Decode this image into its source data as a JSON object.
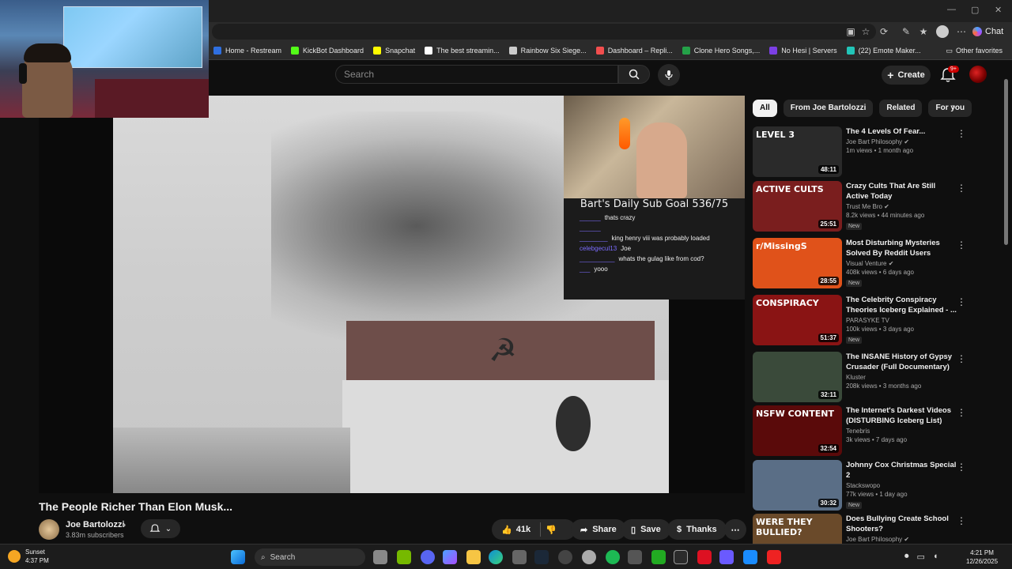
{
  "window": {
    "minimize": "—",
    "maximize": "▢",
    "close": "✕"
  },
  "address_bar": {
    "chat_label": "Chat"
  },
  "bookmarks": [
    {
      "label": "Home - Restream",
      "color": "#2f6fe0"
    },
    {
      "label": "KickBot Dashboard",
      "color": "#53fc18"
    },
    {
      "label": "Snapchat",
      "color": "#fffc00"
    },
    {
      "label": "The best streamin...",
      "color": "#ffffff"
    },
    {
      "label": "Rainbow Six Siege...",
      "color": "#cccccc"
    },
    {
      "label": "Dashboard – Repli...",
      "color": "#f24e4e"
    },
    {
      "label": "Clone Hero Songs,...",
      "color": "#24a148"
    },
    {
      "label": "No Hesi | Servers",
      "color": "#7b3fe4"
    },
    {
      "label": "(22) Emote Maker...",
      "color": "#22c5b8"
    }
  ],
  "other_favorites": "Other favorites",
  "header": {
    "search_placeholder": "Search",
    "create_label": "Create",
    "notif_count": "9+"
  },
  "player": {
    "sub_goal": "Bart's Daily Sub Goal 536/75",
    "chat": [
      {
        "user": "______",
        "message": "thats crazy"
      },
      {
        "user": "______",
        "message": ""
      },
      {
        "user": "________",
        "message": "king henry viii was probably loaded"
      },
      {
        "user": "celebgecul13",
        "message": "Joe"
      },
      {
        "user": "__________",
        "message": "whats the gulag like from cod?"
      },
      {
        "user": "___",
        "message": "yooo"
      }
    ]
  },
  "video": {
    "title": "The People Richer Than Elon Musk...",
    "channel": "Joe Bartolozzi",
    "subscribers": "3.83m subscribers",
    "likes": "41k",
    "share": "Share",
    "save": "Save",
    "thanks": "Thanks"
  },
  "chips": [
    "All",
    "From Joe Bartolozzi",
    "Related",
    "For you"
  ],
  "recommendations": [
    {
      "title": "The 4 Levels Of Fear...",
      "channel": "Joe Bart Philosophy",
      "verified": true,
      "meta": "1m views • 1 month ago",
      "duration": "48:11",
      "badge": "",
      "thumb_text": "LEVEL 3",
      "thumb_color": "#2a2a2a"
    },
    {
      "title": "Crazy Cults That Are Still Active Today",
      "channel": "Trust Me Bro",
      "verified": true,
      "meta": "8.2k views • 44 minutes ago",
      "duration": "25:51",
      "badge": "New",
      "thumb_text": "ACTIVE CULTS",
      "thumb_color": "#7a1e1e"
    },
    {
      "title": "Most Disturbing Mysteries Solved By Reddit Users",
      "channel": "Visual Venture",
      "verified": true,
      "meta": "408k views • 6 days ago",
      "duration": "28:55",
      "badge": "New",
      "thumb_text": "r/MissingS",
      "thumb_color": "#e0521a"
    },
    {
      "title": "The Celebrity Conspiracy Theories Iceberg Explained - ...",
      "channel": "PARASYKE TV",
      "verified": false,
      "meta": "100k views • 3 days ago",
      "duration": "51:37",
      "badge": "New",
      "thumb_text": "CONSPIRACY",
      "thumb_color": "#8a1414"
    },
    {
      "title": "The INSANE History of Gypsy Crusader (Full Documentary)",
      "channel": "Kluster",
      "verified": false,
      "meta": "208k views • 3 months ago",
      "duration": "32:11",
      "badge": "",
      "thumb_text": "",
      "thumb_color": "#3a4a3a"
    },
    {
      "title": "The Internet's Darkest Videos (DISTURBING Iceberg List)",
      "channel": "Tenebris",
      "verified": false,
      "meta": "3k views • 7 days ago",
      "duration": "32:54",
      "badge": "",
      "thumb_text": "NSFW CONTENT",
      "thumb_color": "#5a0a0a"
    },
    {
      "title": "Johnny Cox Christmas Special 2",
      "channel": "Stackswopo",
      "verified": false,
      "meta": "77k views • 1 day ago",
      "duration": "30:32",
      "badge": "New",
      "thumb_text": "",
      "thumb_color": "#5a6e86"
    },
    {
      "title": "Does Bullying Create School Shooters?",
      "channel": "Joe Bart Philosophy",
      "verified": true,
      "meta": "",
      "duration": "",
      "badge": "",
      "thumb_text": "WERE THEY BULLIED?",
      "thumb_color": "#6a4a2a"
    }
  ],
  "taskbar": {
    "weather_label": "Sunset",
    "weather_time": "4:37 PM",
    "search_label": "Search",
    "clock_time": "4:21 PM",
    "clock_date": "12/26/2025"
  }
}
